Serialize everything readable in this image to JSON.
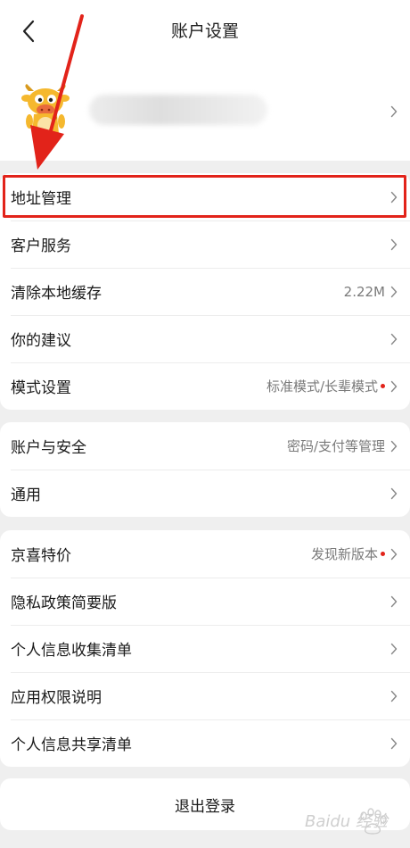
{
  "header": {
    "title": "账户设置"
  },
  "card1": {
    "items": [
      {
        "label": "地址管理",
        "value": ""
      },
      {
        "label": "客户服务",
        "value": ""
      },
      {
        "label": "清除本地缓存",
        "value": "2.22M"
      },
      {
        "label": "你的建议",
        "value": ""
      },
      {
        "label": "模式设置",
        "value": "标准模式/长辈模式"
      }
    ]
  },
  "card2": {
    "items": [
      {
        "label": "账户与安全",
        "value": "密码/支付等管理"
      },
      {
        "label": "通用",
        "value": ""
      }
    ]
  },
  "card3": {
    "items": [
      {
        "label": "京喜特价",
        "value": "发现新版本"
      },
      {
        "label": "隐私政策简要版",
        "value": ""
      },
      {
        "label": "个人信息收集清单",
        "value": ""
      },
      {
        "label": "应用权限说明",
        "value": ""
      },
      {
        "label": "个人信息共享清单",
        "value": ""
      }
    ]
  },
  "footer": {
    "logout_label": "退出登录"
  },
  "watermark": {
    "text": "Baidu 经验"
  },
  "colors": {
    "accent_red": "#e2231a",
    "background": "#efefef"
  }
}
